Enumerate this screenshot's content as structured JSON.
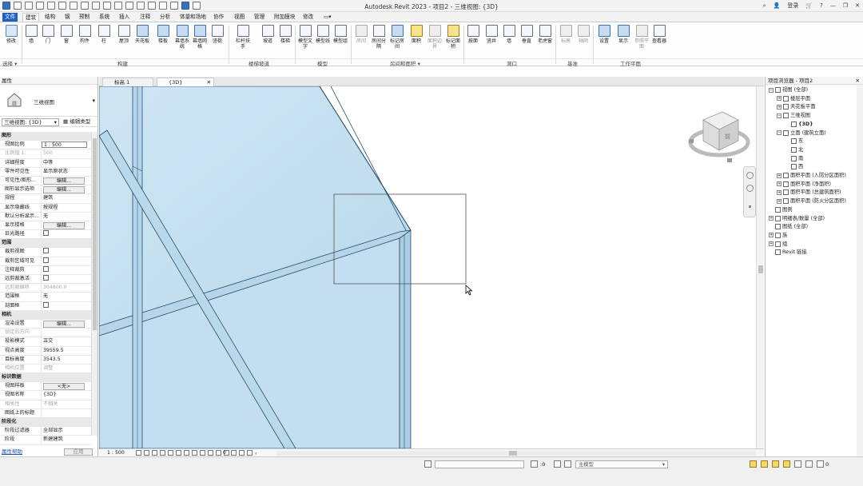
{
  "titlebar": {
    "title": "Autodesk Revit 2023 - 项目2 - 三维视图: {3D}",
    "login": "登录"
  },
  "menu": {
    "tabs": [
      {
        "label": "文件"
      },
      {
        "label": "建筑"
      },
      {
        "label": "结构"
      },
      {
        "label": "钢"
      },
      {
        "label": "预制"
      },
      {
        "label": "系统"
      },
      {
        "label": "插入"
      },
      {
        "label": "注释"
      },
      {
        "label": "分析"
      },
      {
        "label": "体量和场地"
      },
      {
        "label": "协作"
      },
      {
        "label": "视图"
      },
      {
        "label": "管理"
      },
      {
        "label": "附加模块"
      },
      {
        "label": "修改"
      }
    ]
  },
  "ribbon": {
    "buttons": [
      {
        "label": "修改"
      },
      {
        "label": "墙"
      },
      {
        "label": "门"
      },
      {
        "label": "窗"
      },
      {
        "label": "构件"
      },
      {
        "label": "柱"
      },
      {
        "label": "屋顶"
      },
      {
        "label": "天花板"
      },
      {
        "label": "楼板"
      },
      {
        "label": "幕墙系统"
      },
      {
        "label": "幕墙网格"
      },
      {
        "label": "竖梃"
      },
      {
        "label": "栏杆扶手"
      },
      {
        "label": "坡道"
      },
      {
        "label": "楼梯"
      },
      {
        "label": "模型文字"
      },
      {
        "label": "模型线"
      },
      {
        "label": "模型组"
      },
      {
        "label": "房间"
      },
      {
        "label": "房间分隔"
      },
      {
        "label": "标记房间"
      },
      {
        "label": "面积"
      },
      {
        "label": "面积边界"
      },
      {
        "label": "标记面积"
      },
      {
        "label": "按面"
      },
      {
        "label": "竖井"
      },
      {
        "label": "墙"
      },
      {
        "label": "垂直"
      },
      {
        "label": "老虎窗"
      },
      {
        "label": "标高"
      },
      {
        "label": "轴网"
      },
      {
        "label": "设置"
      },
      {
        "label": "显示"
      },
      {
        "label": "参照平面"
      },
      {
        "label": "查看器"
      }
    ],
    "groups": [
      {
        "label": "选择 ▾"
      },
      {
        "label": "构建"
      },
      {
        "label": "楼梯坡道"
      },
      {
        "label": "模型"
      },
      {
        "label": "房间和面积 ▾"
      },
      {
        "label": "洞口"
      },
      {
        "label": "基准"
      },
      {
        "label": "工作平面"
      }
    ]
  },
  "properties": {
    "header": "属性",
    "type_name": "三维视图",
    "type_selector": "三维视图: {3D}",
    "edit_type": "编辑类型",
    "rows": [
      {
        "cat": "图形"
      },
      {
        "k": "视图比例",
        "v": "1 : 500",
        "box": true
      },
      {
        "k": "比例值 1:",
        "v": "500",
        "muted": true
      },
      {
        "k": "详细程度",
        "v": "中等"
      },
      {
        "k": "零件可见性",
        "v": "显示原状态"
      },
      {
        "k": "可见性/图形...",
        "btn": "编辑..."
      },
      {
        "k": "图形显示选项",
        "btn": "编辑..."
      },
      {
        "k": "规程",
        "v": "建筑"
      },
      {
        "k": "显示隐藏线",
        "v": "按规程"
      },
      {
        "k": "默认分析显示...",
        "v": "无"
      },
      {
        "k": "显示楼格",
        "btn": "编辑..."
      },
      {
        "k": "日光路径",
        "check": true
      },
      {
        "cat": "范围"
      },
      {
        "k": "裁剪视图",
        "check": true
      },
      {
        "k": "裁剪区域可见",
        "check": true
      },
      {
        "k": "注释裁剪",
        "check": true
      },
      {
        "k": "远剪裁激活",
        "check": true
      },
      {
        "k": "远剪裁偏移",
        "v": "304800.0",
        "muted": true
      },
      {
        "k": "范围框",
        "v": "无"
      },
      {
        "k": "剖面框",
        "check": true
      },
      {
        "cat": "相机"
      },
      {
        "k": "渲染设置",
        "btn": "编辑..."
      },
      {
        "k": "锁定的方向",
        "v": "",
        "muted": true
      },
      {
        "k": "投影模式",
        "v": "正交"
      },
      {
        "k": "视点高度",
        "v": "39559.5"
      },
      {
        "k": "目标高度",
        "v": "3543.5"
      },
      {
        "k": "相机位置",
        "v": "调整",
        "muted": true
      },
      {
        "cat": "标识数据"
      },
      {
        "k": "视图样板",
        "btn": "<无>"
      },
      {
        "k": "视图名称",
        "v": "{3D}"
      },
      {
        "k": "相关性",
        "v": "不相关",
        "muted": true
      },
      {
        "k": "图纸上的标题",
        "v": ""
      },
      {
        "cat": "阶段化"
      },
      {
        "k": "阶段过滤器",
        "v": "全部显示"
      },
      {
        "k": "阶段",
        "v": "新建建筑"
      }
    ],
    "help_link": "属性帮助",
    "apply": "应用"
  },
  "view_tabs": [
    {
      "label": "标高 1"
    },
    {
      "label": "{3D}",
      "active": true
    }
  ],
  "viewbar": {
    "scale": "1 : 500",
    "count": "0"
  },
  "viewcube": {
    "face_label": "前"
  },
  "browser": {
    "header": "项目浏览器 - 项目2",
    "nodes": [
      {
        "label": "视图 (全部)",
        "indent": 0,
        "tog": "−"
      },
      {
        "label": "楼层平面",
        "indent": 1,
        "tog": "+"
      },
      {
        "label": "天花板平面",
        "indent": 1,
        "tog": "+"
      },
      {
        "label": "三维视图",
        "indent": 1,
        "tog": "−"
      },
      {
        "label": "{3D}",
        "indent": 2,
        "bold": true
      },
      {
        "label": "立面 (建筑立面)",
        "indent": 1,
        "tog": "−"
      },
      {
        "label": "东",
        "indent": 2
      },
      {
        "label": "北",
        "indent": 2
      },
      {
        "label": "南",
        "indent": 2
      },
      {
        "label": "西",
        "indent": 2
      },
      {
        "label": "面积平面 (人防分区面积)",
        "indent": 1,
        "tog": "+"
      },
      {
        "label": "面积平面 (净面积)",
        "indent": 1,
        "tog": "+"
      },
      {
        "label": "面积平面 (总建筑面积)",
        "indent": 1,
        "tog": "+"
      },
      {
        "label": "面积平面 (防火分区面积)",
        "indent": 1,
        "tog": "+"
      },
      {
        "label": "图例",
        "indent": 0
      },
      {
        "label": "明细表/数量 (全部)",
        "indent": 0,
        "tog": "+"
      },
      {
        "label": "图纸 (全部)",
        "indent": 0
      },
      {
        "label": "族",
        "indent": 0,
        "tog": "+"
      },
      {
        "label": "组",
        "indent": 0,
        "tog": "+"
      },
      {
        "label": "Revit 链接",
        "indent": 0
      }
    ]
  },
  "statusbar": {
    "zero": ":0",
    "model": "主模型"
  }
}
